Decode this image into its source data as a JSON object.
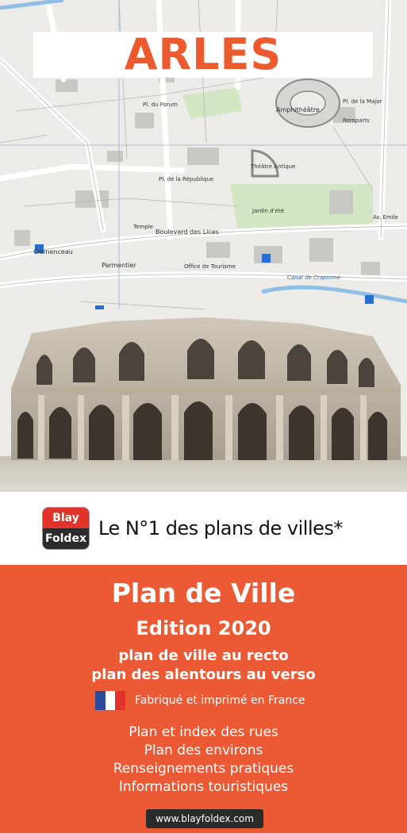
{
  "cover": {
    "title": "ARLES",
    "map_labels": {
      "amphitheatre": "Amphithéâtre",
      "boulevard": "Boulevard des Lices",
      "clemenceau": "Clemenceau",
      "parmentier": "Parmentier",
      "temple": "Temple",
      "remparts": "Remparts",
      "canal": "Canal de Craponne",
      "theatre": "Théâtre Antique",
      "office": "Office de Tourisme",
      "jardin": "Jardin d'été",
      "republique": "Pl. de la République",
      "forum": "Pl. du Forum",
      "major": "Pl. de la Major",
      "emile": "Av. Emile"
    },
    "brand": {
      "top": "Blay",
      "bottom": "Foldex"
    },
    "tagline": "Le N°1 des plans de villes*",
    "heading": "Plan de Ville",
    "edition": "Edition 2020",
    "recto": "plan de ville au recto",
    "verso": "plan des alentours au verso",
    "made_in": "Fabriqué et imprimé en France",
    "flag_colors": [
      "#2b4a9a",
      "#ffffff",
      "#e0342a"
    ],
    "features": [
      "Plan et index des rues",
      "Plan des environs",
      "Renseignements pratiques",
      "Informations touristiques"
    ],
    "website": "www.blayfoldex.com",
    "colors": {
      "accent": "#eb5a34",
      "title": "#ec5a2e",
      "logo_red": "#e0342a",
      "dark": "#2b2b2b"
    }
  }
}
